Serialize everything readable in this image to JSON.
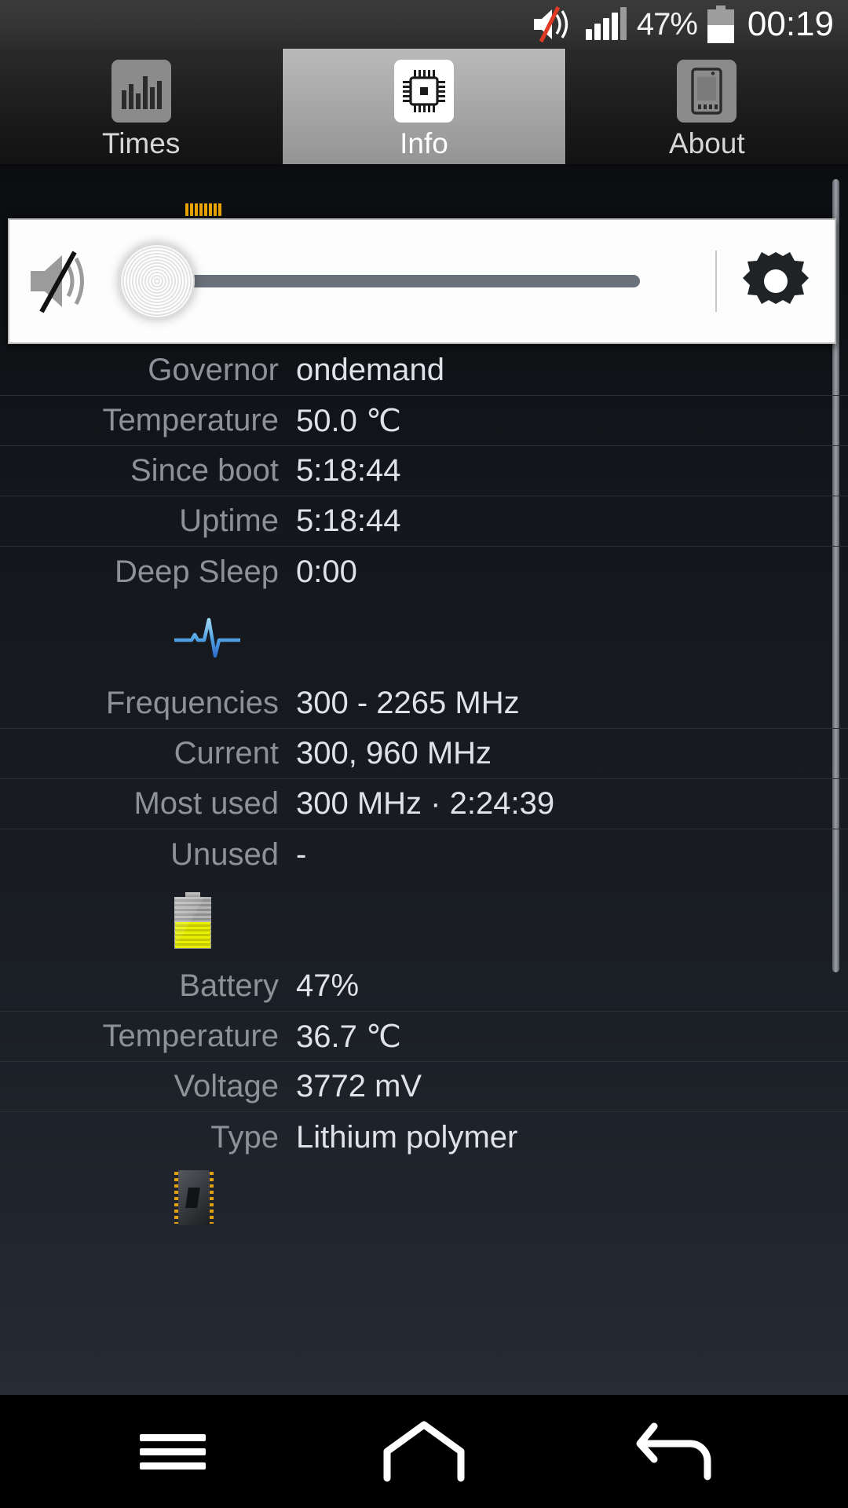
{
  "status_bar": {
    "mute_icon": "volume-mute-icon",
    "signal_icon": "signal-bars-icon",
    "battery_percent": "47%",
    "battery_icon": "battery-icon",
    "clock": "00:19"
  },
  "tabs": [
    {
      "label": "Times",
      "icon": "bar-chart-icon",
      "active": false
    },
    {
      "label": "Info",
      "icon": "cpu-chip-icon",
      "active": true
    },
    {
      "label": "About",
      "icon": "phone-icon",
      "active": false
    }
  ],
  "volume_overlay": {
    "mute_icon": "speaker-muted-icon",
    "settings_icon": "gear-icon",
    "slider_value": 0,
    "slider_min": 0,
    "slider_max": 100
  },
  "sections": [
    {
      "icon": "cpu-chip-icon",
      "rows": [
        {
          "label": "Governor",
          "value": "ondemand"
        },
        {
          "label": "Temperature",
          "value": "50.0 ℃"
        },
        {
          "label": "Since boot",
          "value": "5:18:44"
        },
        {
          "label": "Uptime",
          "value": "5:18:44"
        },
        {
          "label": "Deep Sleep",
          "value": "0:00"
        }
      ]
    },
    {
      "icon": "pulse-wave-icon",
      "rows": [
        {
          "label": "Frequencies",
          "value": "300 - 2265 MHz"
        },
        {
          "label": "Current",
          "value": "300, 960 MHz"
        },
        {
          "label": "Most used",
          "value": "300 MHz · 2:24:39"
        },
        {
          "label": "Unused",
          "value": "-"
        }
      ]
    },
    {
      "icon": "battery-icon",
      "rows": [
        {
          "label": "Battery",
          "value": "47%"
        },
        {
          "label": "Temperature",
          "value": "36.7 ℃"
        },
        {
          "label": "Voltage",
          "value": "3772 mV"
        },
        {
          "label": "Type",
          "value": "Lithium polymer"
        }
      ]
    },
    {
      "icon": "memory-chip-icon",
      "rows": []
    }
  ],
  "nav_bar": {
    "menu_icon": "menu-icon",
    "home_icon": "home-icon",
    "back_icon": "back-icon"
  },
  "colors": {
    "accent_blue": "#5aa9e6",
    "battery_yellow": "#e8f000",
    "chip_orange": "#e8a400",
    "label_gray": "#8d9198",
    "value_gray": "#dfe2e6",
    "mute_red": "#e03a22"
  }
}
